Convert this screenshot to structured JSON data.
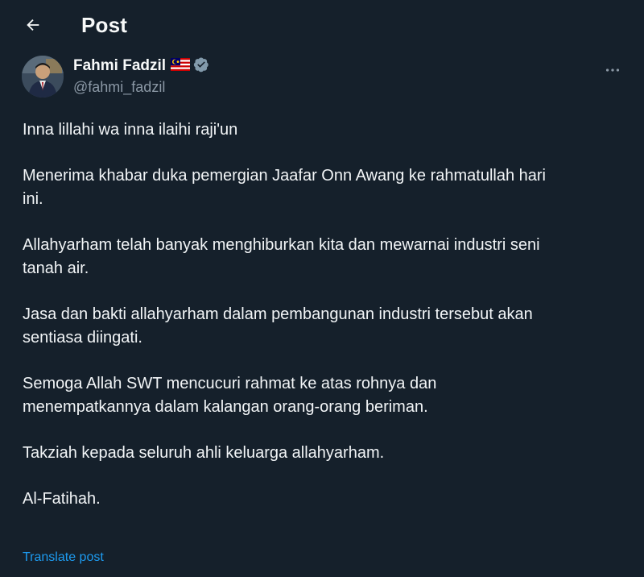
{
  "header": {
    "title": "Post",
    "back_icon": "arrow-left-icon"
  },
  "author": {
    "name": "Fahmi Fadzil",
    "handle": "@fahmi_fadzil",
    "flag_icon": "malaysia-flag-icon",
    "verified_icon": "verified-badge-icon",
    "verified_color": "#829aab"
  },
  "menu": {
    "more_icon": "more-horizontal-icon"
  },
  "post": {
    "paragraphs": [
      "Inna lillahi wa inna ilaihi raji'un",
      "Menerima khabar duka pemergian Jaafar Onn Awang ke rahmatullah hari\nini.",
      "Allahyarham telah banyak menghiburkan kita dan mewarnai industri seni\ntanah air.",
      "Jasa dan bakti allahyarham dalam pembangunan industri tersebut akan\nsentiasa diingati.",
      "Semoga Allah SWT mencucuri rahmat ke atas rohnya dan\nmenempatkannya dalam kalangan orang-orang beriman.",
      "Takziah kepada seluruh ahli keluarga allahyarham.",
      "Al-Fatihah."
    ],
    "translate_label": "Translate post"
  },
  "colors": {
    "background": "#15202b",
    "text": "#f7f9f9",
    "secondary_text": "#8b98a5",
    "link": "#1d9bf0"
  }
}
